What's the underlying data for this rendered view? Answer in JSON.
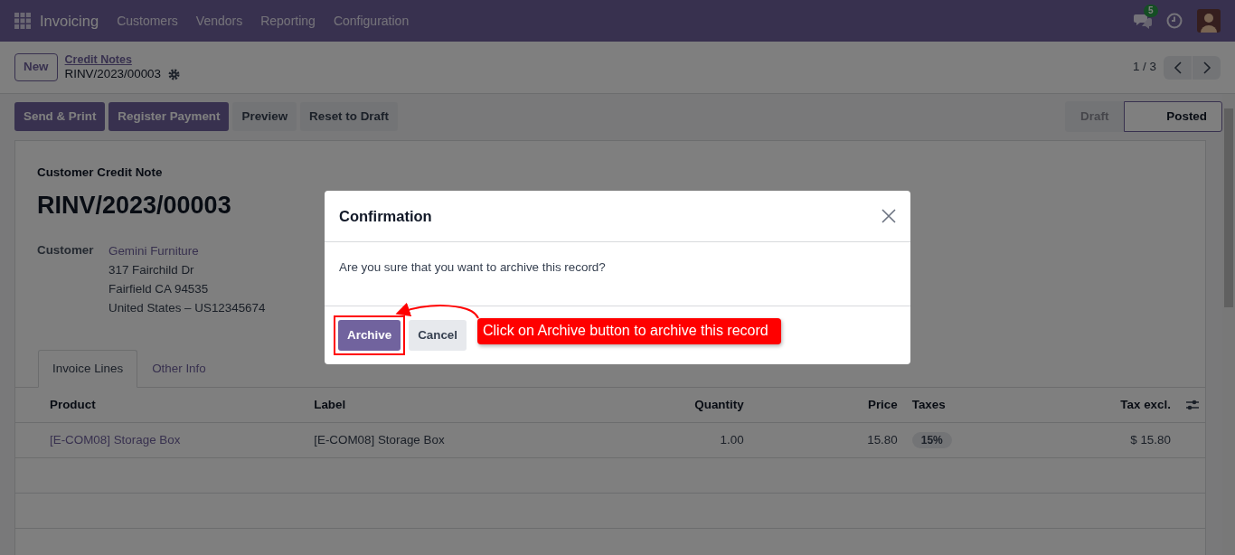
{
  "navbar": {
    "app": "Invoicing",
    "menu": [
      "Customers",
      "Vendors",
      "Reporting",
      "Configuration"
    ],
    "message_count": "5"
  },
  "breadcrumb": {
    "new_button": "New",
    "parent": "Credit Notes",
    "current": "RINV/2023/00003"
  },
  "pager": {
    "value": "1 / 3"
  },
  "actions": [
    {
      "label": "Send & Print",
      "kind": "primary"
    },
    {
      "label": "Register Payment",
      "kind": "primary"
    },
    {
      "label": "Preview",
      "kind": "secondary"
    },
    {
      "label": "Reset to Draft",
      "kind": "secondary"
    }
  ],
  "status_steps": [
    {
      "label": "Draft",
      "selected": false
    },
    {
      "label": "Posted",
      "selected": true
    }
  ],
  "form": {
    "type_label": "Customer Credit Note",
    "number": "RINV/2023/00003",
    "customer_label": "Customer",
    "customer_name": "Gemini Furniture",
    "address_lines": [
      "317 Fairchild Dr",
      "Fairfield CA 94535",
      "United States – US12345674"
    ]
  },
  "tabs": [
    {
      "label": "Invoice Lines",
      "selected": true
    },
    {
      "label": "Other Info",
      "selected": false
    }
  ],
  "table": {
    "columns": [
      "Product",
      "Label",
      "Quantity",
      "Price",
      "Taxes",
      "Tax excl."
    ],
    "rows": [
      {
        "cells": [
          {
            "kind": "link",
            "text": "[E-COM08] Storage Box"
          },
          {
            "kind": "text",
            "text": "[E-COM08] Storage Box"
          },
          {
            "kind": "text",
            "text": "1.00"
          },
          {
            "kind": "text",
            "text": "15.80"
          },
          {
            "kind": "badge",
            "text": "15%"
          },
          {
            "kind": "text",
            "text": "$ 15.80"
          }
        ]
      }
    ]
  },
  "dialog": {
    "title": "Confirmation",
    "message": "Are you sure that you want to archive this record?",
    "buttons": [
      {
        "label": "Archive",
        "kind": "primary"
      },
      {
        "label": "Cancel",
        "kind": "secondary"
      }
    ]
  },
  "annotation": {
    "text": "Click on Archive button to archive this record"
  }
}
